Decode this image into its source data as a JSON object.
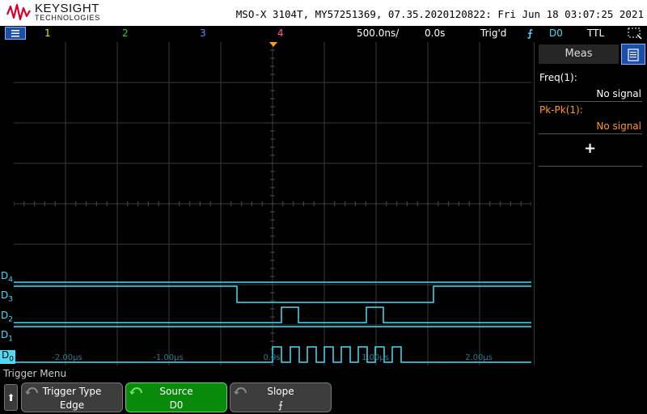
{
  "header": {
    "brand": "KEYSIGHT",
    "brand_sub": "TECHNOLOGIES",
    "title": "MSO-X 3104T, MY57251369, 07.35.2020120822: Fri Jun 18 03:07:25 2021"
  },
  "status": {
    "ch1": "1",
    "ch2": "2",
    "ch3": "3",
    "ch4": "4",
    "timebase": "500.0ns/",
    "delay": "0.0s",
    "trig_state": "Trig'd",
    "trig_source": "D0",
    "logic": "TTL"
  },
  "colors": {
    "ch1": "#f2e600",
    "ch2": "#28d228",
    "ch3": "#4a6bff",
    "ch4": "#ff4fa3",
    "digital": "#4fd9f2",
    "accent_orange": "#ff9a1a"
  },
  "digital_labels": [
    "D4",
    "D3",
    "D2",
    "D1",
    "D0"
  ],
  "time_ticks": [
    "-2.00µs",
    "-1.00µs",
    "0.0s",
    "1.00µs",
    "2.00µs"
  ],
  "meas": {
    "tab": "Meas",
    "items": [
      {
        "label": "Freq(1):",
        "value": "No signal"
      },
      {
        "label": "Pk-Pk(1):",
        "value": "No signal"
      }
    ]
  },
  "menu": {
    "title": "Trigger Menu",
    "softkeys": [
      {
        "title": "Trigger Type",
        "value": "Edge"
      },
      {
        "title": "Source",
        "value": "D0"
      },
      {
        "title": "Slope",
        "value": "⨍"
      }
    ]
  }
}
